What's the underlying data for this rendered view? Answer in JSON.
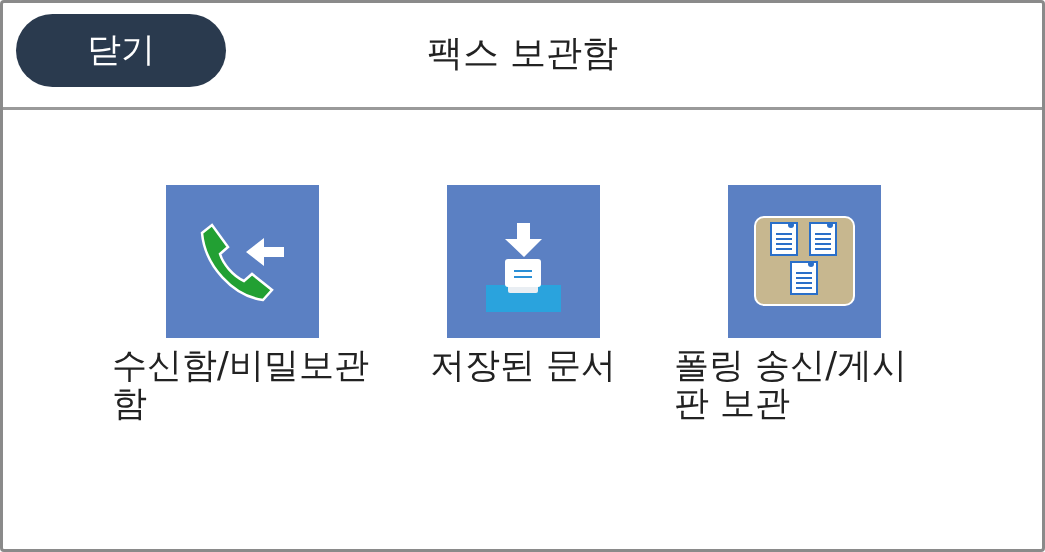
{
  "header": {
    "close_button": "닫기",
    "title": "팩스 보관함"
  },
  "items": [
    {
      "kind": "phone",
      "label": "수신함/비밀보관함"
    },
    {
      "kind": "tray",
      "label": "저장된 문서"
    },
    {
      "kind": "board",
      "label": "폴링 송신/게시판 보관"
    }
  ]
}
